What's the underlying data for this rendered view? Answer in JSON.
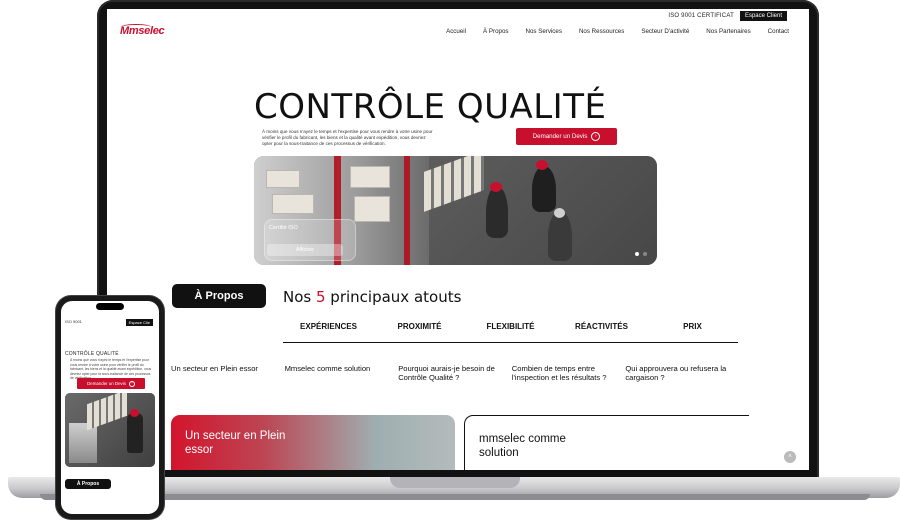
{
  "topbar": {
    "iso": "ISO 9001 CERTIFICAT",
    "espace_client": "Espace Client"
  },
  "logo": {
    "text": "Mmselec",
    "brand_color": "#c8102e"
  },
  "nav": {
    "items": [
      "Accueil",
      "À Propos",
      "Nos Services",
      "Nos Ressources",
      "Secteur D'activité",
      "Nos Partenaires",
      "Contact"
    ]
  },
  "hero": {
    "title": "CONTRÔLE QUALITÉ",
    "description": "À moins que vous n'ayez le temps et l'expertise pour vous rendre à votre usine pour vérifier le profil du fabricant, les biens et la qualité avant expédition, vous devriez opter pour la sous-traitance de ces processus de vérification.",
    "cta": "Demander un Devis",
    "badge_text": "Certifié ISO",
    "badge_button": "Afficher"
  },
  "about": {
    "pill": "À Propos",
    "heading_before": "Nos ",
    "heading_number": "5",
    "heading_after": " principaux atouts",
    "tabs": [
      "EXPÉRIENCES",
      "PROXIMITÉ",
      "FLEXIBILITÉ",
      "RÉACTIVITÉS",
      "PRIX"
    ],
    "features": [
      "Un secteur en Plein essor",
      "Mmselec comme solution",
      "Pourquoi aurais-je besoin de Contrôle Qualité ?",
      "Combien de temps entre l'inspection et les résultats ?",
      "Qui approuvera ou refusera la cargaison ?"
    ],
    "card_red": "Un secteur en Plein essor",
    "card_white": "mmselec comme solution"
  },
  "phone": {
    "iso": "ISO 9001",
    "espace_client": "Espace Clie",
    "title": "CONTRÔLE QUALITÉ",
    "description": "À moins que vous n'ayez le temps et l'expertise pour vous rendre à votre usine pour vérifier le profil du fabricant, les biens et la qualité avant expédition, vous devriez opter pour la sous-traitance de ces processus de vérification.",
    "cta": "Demander un Devis",
    "pill": "À Propos"
  },
  "icons": {
    "arrow": "arrow-right-icon",
    "scroll": "chevron-up-icon"
  }
}
